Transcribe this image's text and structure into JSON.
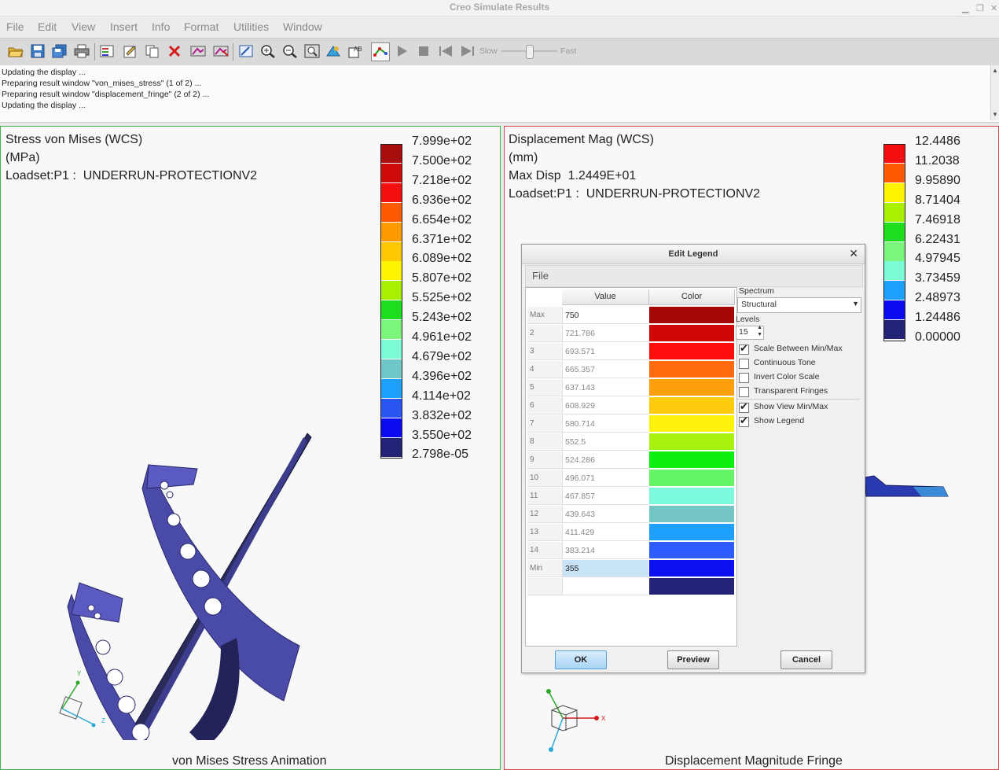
{
  "window": {
    "title": "Creo Simulate Results"
  },
  "menubar": [
    "File",
    "Edit",
    "View",
    "Insert",
    "Info",
    "Format",
    "Utilities",
    "Window"
  ],
  "toolbar": {
    "slow_label": "Slow",
    "fast_label": "Fast"
  },
  "messages": [
    "Updating the display ...",
    "Preparing result window \"von_mises_stress\" (1 of 2) ...",
    "Preparing result window \"displacement_fringe\" (2 of 2) ...",
    "Updating the display ..."
  ],
  "left_pane": {
    "title": "Stress von Mises (WCS)",
    "units": "(MPa)",
    "loadset": "Loadset:P1 :  UNDERRUN-PROTECTIONV2",
    "caption": "von Mises Stress Animation",
    "legend": [
      "7.999e+02",
      "7.500e+02",
      "7.218e+02",
      "6.936e+02",
      "6.654e+02",
      "6.371e+02",
      "6.089e+02",
      "5.807e+02",
      "5.525e+02",
      "5.243e+02",
      "4.961e+02",
      "4.679e+02",
      "4.396e+02",
      "4.114e+02",
      "3.832e+02",
      "3.550e+02",
      "2.798e-05"
    ],
    "legend_colors": [
      "#a80d0d",
      "#cf0a0a",
      "#f50f0f",
      "#ff5a00",
      "#ff9a00",
      "#ffc800",
      "#fff400",
      "#a8f000",
      "#1edc1e",
      "#7cf57c",
      "#7dfad6",
      "#6ec7c6",
      "#1ea0ff",
      "#2a55f0",
      "#0a0af0",
      "#232378"
    ],
    "axes": {
      "y": "Y",
      "z": "Z"
    }
  },
  "right_pane": {
    "title": "Displacement Mag (WCS)",
    "units": "(mm)",
    "maxdisp": "Max Disp  1.2449E+01",
    "loadset": "Loadset:P1 :  UNDERRUN-PROTECTIONV2",
    "caption": "Displacement Magnitude Fringe",
    "legend": [
      "12.4486",
      "11.2038",
      "9.95890",
      "8.71404",
      "7.46918",
      "6.22431",
      "4.97945",
      "3.73459",
      "2.48973",
      "1.24486",
      "0.00000"
    ],
    "legend_colors": [
      "#f50f0f",
      "#ff5a00",
      "#fff400",
      "#a8f000",
      "#1edc1e",
      "#7cf57c",
      "#7dfad6",
      "#1ea0ff",
      "#0a0af0",
      "#232378"
    ],
    "axes": {
      "x": "X"
    }
  },
  "dialog": {
    "title": "Edit Legend",
    "menu_file": "File",
    "col_value": "Value",
    "col_color": "Color",
    "rows": [
      {
        "label": "Max",
        "value": "750",
        "color": "#a30707"
      },
      {
        "label": "2",
        "value": "721.786",
        "color": "#d00707"
      },
      {
        "label": "3",
        "value": "693.571",
        "color": "#ff0d0d"
      },
      {
        "label": "4",
        "value": "665.357",
        "color": "#ff6a0d"
      },
      {
        "label": "5",
        "value": "637.143",
        "color": "#ff9e0d"
      },
      {
        "label": "6",
        "value": "608.929",
        "color": "#ffcb0d"
      },
      {
        "label": "7",
        "value": "580.714",
        "color": "#fff20d"
      },
      {
        "label": "8",
        "value": "552.5",
        "color": "#a8f00d"
      },
      {
        "label": "9",
        "value": "524.286",
        "color": "#0df00d"
      },
      {
        "label": "10",
        "value": "496.071",
        "color": "#66f566"
      },
      {
        "label": "11",
        "value": "467.857",
        "color": "#7dfadc"
      },
      {
        "label": "12",
        "value": "439.643",
        "color": "#73c6c4"
      },
      {
        "label": "13",
        "value": "411.429",
        "color": "#1ea0ff"
      },
      {
        "label": "14",
        "value": "383.214",
        "color": "#2e5cff"
      },
      {
        "label": "Min",
        "value": "355",
        "color": "#0a10f0"
      },
      {
        "label": "",
        "value": "",
        "color": "#232378"
      }
    ],
    "spectrum_label": "Spectrum",
    "spectrum_value": "Structural",
    "levels_label": "Levels",
    "levels_value": "15",
    "options": [
      {
        "label": "Scale Between Min/Max",
        "checked": true
      },
      {
        "label": "Continuous Tone",
        "checked": false
      },
      {
        "label": "Invert Color Scale",
        "checked": false
      },
      {
        "label": "Transparent Fringes",
        "checked": false
      },
      {
        "label": "Show View Min/Max",
        "checked": true
      },
      {
        "label": "Show Legend",
        "checked": true
      }
    ],
    "ok": "OK",
    "preview": "Preview",
    "cancel": "Cancel"
  }
}
